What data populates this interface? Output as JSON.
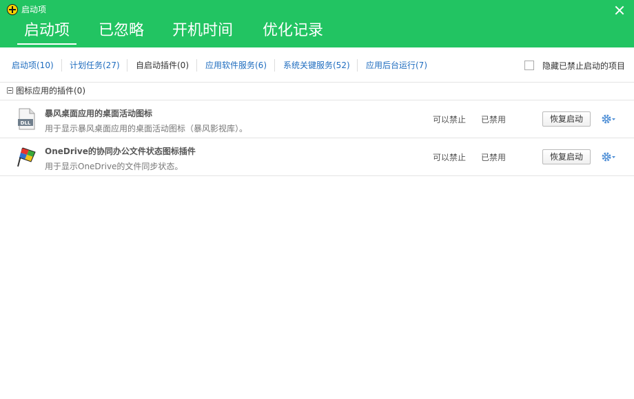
{
  "window": {
    "title": "启动项",
    "logo_icon": "plus-circle-logo-icon",
    "close_icon": "close-icon"
  },
  "main_tabs": [
    {
      "label": "启动项",
      "active": true
    },
    {
      "label": "已忽略"
    },
    {
      "label": "开机时间"
    },
    {
      "label": "优化记录"
    }
  ],
  "sub_tabs": [
    {
      "label": "启动项(10)"
    },
    {
      "label": "计划任务(27)"
    },
    {
      "label": "自启动插件(0)",
      "current": true
    },
    {
      "label": "应用软件服务(6)"
    },
    {
      "label": "系统关键服务(52)"
    },
    {
      "label": "应用后台运行(7)"
    }
  ],
  "hide_disabled": {
    "label": "隐藏已禁止启动的项目",
    "checked": false
  },
  "group": {
    "label": "图标应用的插件(0)",
    "toggle_symbol": "minus-box-icon"
  },
  "items": [
    {
      "name": "暴风桌面应用的桌面活动图标",
      "desc": "用于显示暴风桌面应用的桌面活动图标（暴风影视库）。",
      "advice": "可以禁止",
      "status": "已禁用",
      "button": "恢复启动",
      "icon": "dll-file-icon",
      "icon_text": "DLL"
    },
    {
      "name": "OneDrive的协同办公文件状态图标插件",
      "desc": "用于显示OneDrive的文件同步状态。",
      "advice": "可以禁止",
      "status": "已禁用",
      "button": "恢复启动",
      "icon": "colored-flag-icon"
    }
  ],
  "colors": {
    "header_bg": "#22c462",
    "link_blue": "#1e6cbf",
    "gear_blue": "#4f8fd6"
  }
}
